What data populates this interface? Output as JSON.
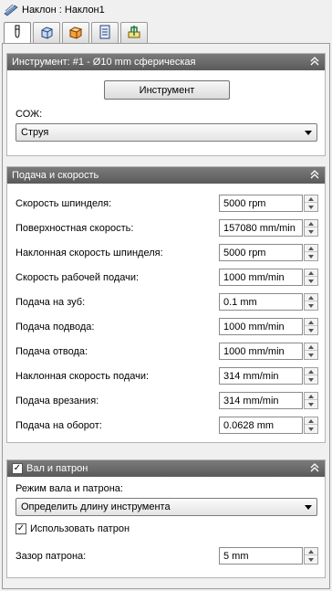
{
  "window": {
    "title": "Наклон : Наклон1"
  },
  "tabs": [
    {
      "icon": "tool-icon",
      "active": true
    },
    {
      "icon": "box-icon",
      "active": false
    },
    {
      "icon": "box-orange-icon",
      "active": false
    },
    {
      "icon": "list-icon",
      "active": false
    },
    {
      "icon": "link-icon",
      "active": false
    }
  ],
  "tool_section": {
    "title": "Инструмент: #1 - Ø10 mm сферическая",
    "tool_button": "Инструмент",
    "coolant_label": "СОЖ:",
    "coolant_value": "Струя"
  },
  "feed_section": {
    "title": "Подача и скорость",
    "rows": [
      {
        "label": "Скорость шпинделя:",
        "value": "5000 rpm"
      },
      {
        "label": "Поверхностная скорость:",
        "value": "157080 mm/min"
      },
      {
        "label": "Наклонная скорость шпинделя:",
        "value": "5000 rpm"
      },
      {
        "label": "Скорость рабочей подачи:",
        "value": "1000 mm/min"
      },
      {
        "label": "Подача на зуб:",
        "value": "0.1 mm"
      },
      {
        "label": "Подача подвода:",
        "value": "1000 mm/min"
      },
      {
        "label": "Подача отвода:",
        "value": "1000 mm/min"
      },
      {
        "label": "Наклонная скорость подачи:",
        "value": "314 mm/min"
      },
      {
        "label": "Подача врезания:",
        "value": "314 mm/min"
      },
      {
        "label": "Подача на оборот:",
        "value": "0.0628 mm"
      }
    ]
  },
  "shaft_section": {
    "title": "Вал и патрон",
    "checked": true,
    "mode_label": "Режим вала и патрона:",
    "mode_value": "Определить длину инструмента",
    "use_holder_label": "Использовать патрон",
    "use_holder_checked": true,
    "clearance_label": "Зазор патрона:",
    "clearance_value": "5 mm"
  },
  "colors": {
    "header_bg": "#6a6a6a",
    "panel_bg": "#f0f0f0"
  }
}
